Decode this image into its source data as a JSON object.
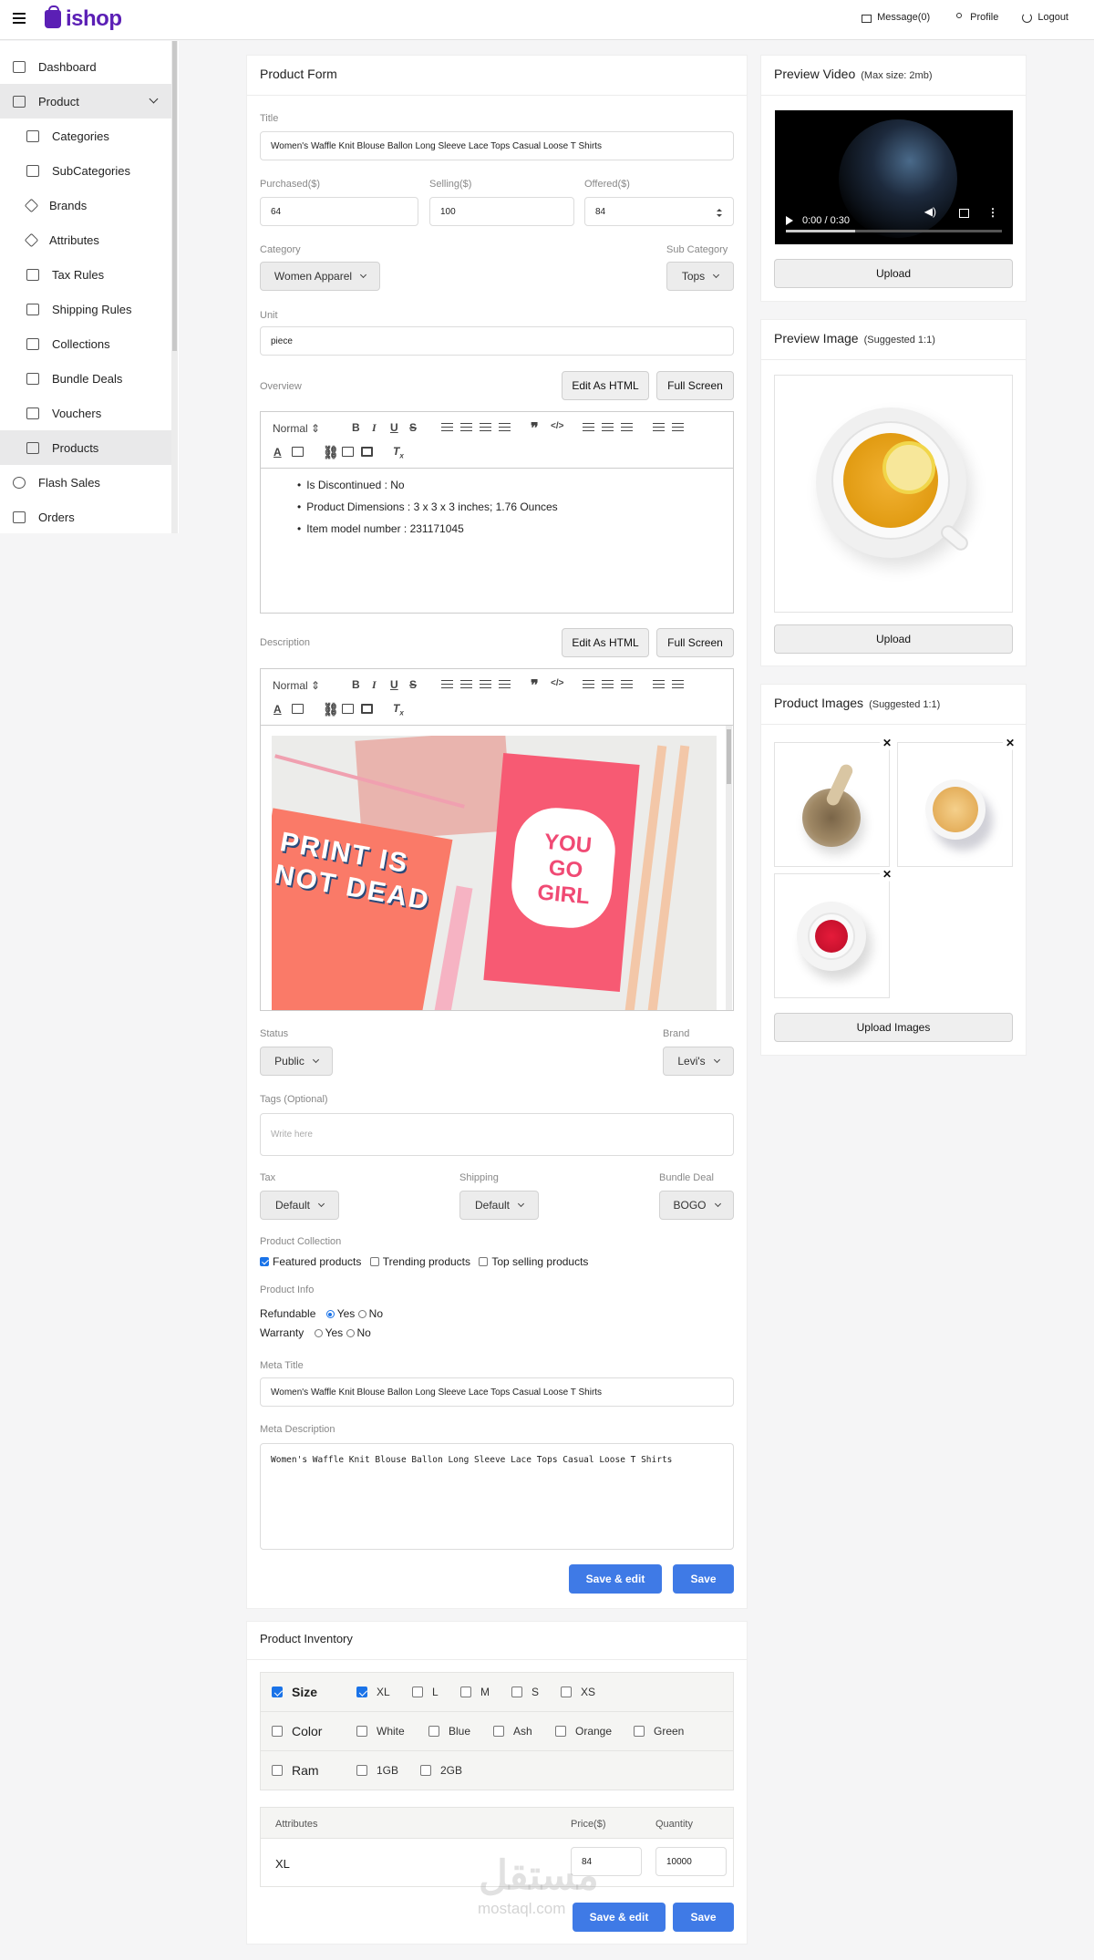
{
  "header": {
    "logo": "ishop",
    "messages": "Message(0)",
    "profile": "Profile",
    "logout": "Logout"
  },
  "sidebar": {
    "items": [
      {
        "label": "Dashboard",
        "icon": "grid-icon"
      },
      {
        "label": "Product",
        "icon": "box-icon"
      },
      {
        "label": "Categories",
        "icon": "grid-icon"
      },
      {
        "label": "SubCategories",
        "icon": "grid-icon"
      },
      {
        "label": "Brands",
        "icon": "tag-icon"
      },
      {
        "label": "Attributes",
        "icon": "tag-icon"
      },
      {
        "label": "Tax Rules",
        "icon": "receipt-icon"
      },
      {
        "label": "Shipping Rules",
        "icon": "truck-icon"
      },
      {
        "label": "Collections",
        "icon": "stack-icon"
      },
      {
        "label": "Bundle Deals",
        "icon": "layers-icon"
      },
      {
        "label": "Vouchers",
        "icon": "ticket-icon"
      },
      {
        "label": "Products",
        "icon": "box-icon"
      },
      {
        "label": "Flash Sales",
        "icon": "percent-icon"
      },
      {
        "label": "Orders",
        "icon": "bag-icon"
      }
    ]
  },
  "form": {
    "title": "Product Form",
    "title_label": "Title",
    "title_value": "Women's Waffle Knit Blouse Ballon Long Sleeve Lace Tops Casual Loose T Shirts",
    "purchased_label": "Purchased($)",
    "purchased_value": "64",
    "selling_label": "Selling($)",
    "selling_value": "100",
    "offered_label": "Offered($)",
    "offered_value": "84",
    "category_label": "Category",
    "category_value": "Women Apparel",
    "subcategory_label": "Sub Category",
    "subcategory_value": "Tops",
    "unit_label": "Unit",
    "unit_value": "piece",
    "overview_label": "Overview",
    "edit_html": "Edit As HTML",
    "full_screen": "Full Screen",
    "editor_style": "Normal",
    "overview_items": [
      "Is Discontinued  :  No",
      "Product Dimensions  :  3 x 3 x 3 inches; 1.76 Ounces",
      "Item model number  :  231171045"
    ],
    "description_label": "Description",
    "desc_image_text_left": "PRINT IS NOT DEAD",
    "desc_image_text_right": "YOU GO GIRL",
    "status_label": "Status",
    "status_value": "Public",
    "brand_label": "Brand",
    "brand_value": "Levi's",
    "tags_label": "Tags (Optional)",
    "tags_placeholder": "Write here",
    "tax_label": "Tax",
    "tax_value": "Default",
    "shipping_label": "Shipping",
    "shipping_value": "Default",
    "bundle_label": "Bundle Deal",
    "bundle_value": "BOGO",
    "collection_label": "Product Collection",
    "collections": [
      {
        "label": "Featured products",
        "checked": true
      },
      {
        "label": "Trending products",
        "checked": false
      },
      {
        "label": "Top selling products",
        "checked": false
      }
    ],
    "info_label": "Product Info",
    "refundable_label": "Refundable",
    "warranty_label": "Warranty",
    "yes": "Yes",
    "no": "No",
    "meta_title_label": "Meta Title",
    "meta_title_value": "Women's Waffle Knit Blouse Ballon Long Sleeve Lace Tops Casual Loose T Shirts",
    "meta_desc_label": "Meta Description",
    "meta_desc_value": "Women's Waffle Knit Blouse Ballon Long Sleeve Lace Tops Casual Loose T Shirts",
    "save_edit": "Save & edit",
    "save": "Save"
  },
  "inventory": {
    "title": "Product Inventory",
    "attributes": [
      {
        "name": "Size",
        "checked": true,
        "options": [
          {
            "label": "XL",
            "checked": true
          },
          {
            "label": "L",
            "checked": false
          },
          {
            "label": "M",
            "checked": false
          },
          {
            "label": "S",
            "checked": false
          },
          {
            "label": "XS",
            "checked": false
          }
        ]
      },
      {
        "name": "Color",
        "checked": false,
        "options": [
          {
            "label": "White",
            "checked": false
          },
          {
            "label": "Blue",
            "checked": false
          },
          {
            "label": "Ash",
            "checked": false
          },
          {
            "label": "Orange",
            "checked": false
          },
          {
            "label": "Green",
            "checked": false
          }
        ]
      },
      {
        "name": "Ram",
        "checked": false,
        "options": [
          {
            "label": "1GB",
            "checked": false
          },
          {
            "label": "2GB",
            "checked": false
          }
        ]
      }
    ],
    "table_headers": {
      "attributes": "Attributes",
      "price": "Price($)",
      "quantity": "Quantity"
    },
    "rows": [
      {
        "attribute": "XL",
        "price": "84",
        "quantity": "10000"
      }
    ],
    "save_edit": "Save & edit",
    "save": "Save"
  },
  "media": {
    "video_title": "Preview Video",
    "video_hint": "(Max size: 2mb)",
    "video_time": "0:00 / 0:30",
    "video_progress": 0.32,
    "upload": "Upload",
    "image_title": "Preview Image",
    "image_hint": "(Suggested 1:1)",
    "images_title": "Product Images",
    "images_hint": "(Suggested 1:1)",
    "upload_images": "Upload Images",
    "close": "✕"
  },
  "watermark": {
    "arabic": "مستقل",
    "latin": "mostaql.com"
  },
  "colors": {
    "brand": "#5b1fb5",
    "primary_button": "#3f7ae6",
    "checkbox": "#1a73e8"
  }
}
